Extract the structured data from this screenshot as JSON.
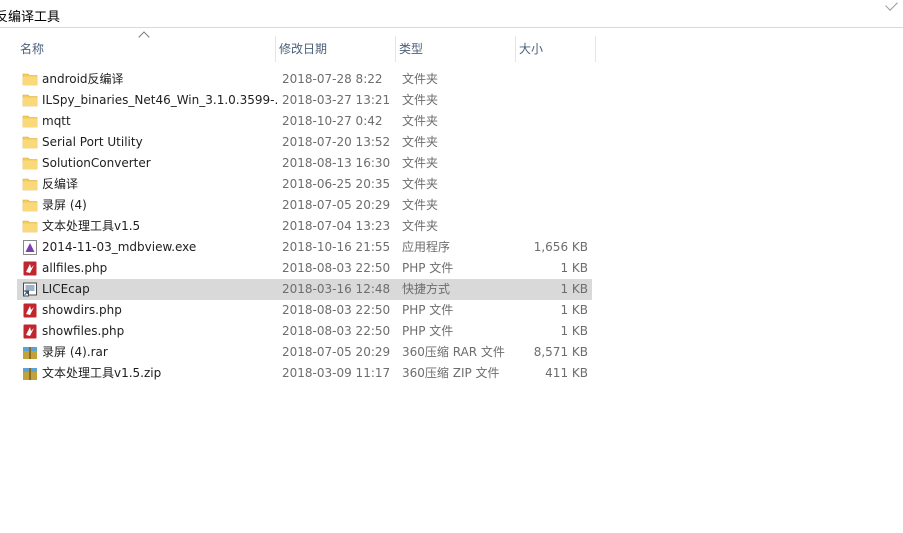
{
  "breadcrumb": {
    "current": "反编译工具"
  },
  "columns": {
    "name": "名称",
    "date": "修改日期",
    "type": "类型",
    "size": "大小"
  },
  "colors": {
    "folder": "#f6cc58",
    "php": "#c0262d",
    "exe": "#7b3fb2",
    "shortcut": "#4a4a4a",
    "archive": "#c2a23a",
    "selected_row": "#d9d9d9"
  },
  "files": [
    {
      "name": "android反编译",
      "date": "2018-07-28 8:22",
      "type": "文件夹",
      "size": "",
      "icon": "folder-icon"
    },
    {
      "name": "ILSpy_binaries_Net46_Win_3.1.0.3599-...",
      "date": "2018-03-27 13:21",
      "type": "文件夹",
      "size": "",
      "icon": "folder-icon"
    },
    {
      "name": "mqtt",
      "date": "2018-10-27 0:42",
      "type": "文件夹",
      "size": "",
      "icon": "folder-icon"
    },
    {
      "name": "Serial Port Utility",
      "date": "2018-07-20 13:52",
      "type": "文件夹",
      "size": "",
      "icon": "folder-icon"
    },
    {
      "name": "SolutionConverter",
      "date": "2018-08-13 16:30",
      "type": "文件夹",
      "size": "",
      "icon": "folder-icon"
    },
    {
      "name": "反编译",
      "date": "2018-06-25 20:35",
      "type": "文件夹",
      "size": "",
      "icon": "folder-icon"
    },
    {
      "name": "录屏 (4)",
      "date": "2018-07-05 20:29",
      "type": "文件夹",
      "size": "",
      "icon": "folder-icon"
    },
    {
      "name": "文本处理工具v1.5",
      "date": "2018-07-04 13:23",
      "type": "文件夹",
      "size": "",
      "icon": "folder-icon"
    },
    {
      "name": "2014-11-03_mdbview.exe",
      "date": "2018-10-16 21:55",
      "type": "应用程序",
      "size": "1,656 KB",
      "icon": "exe-icon"
    },
    {
      "name": "allfiles.php",
      "date": "2018-08-03 22:50",
      "type": "PHP 文件",
      "size": "1 KB",
      "icon": "php-file-icon"
    },
    {
      "name": "LICEcap",
      "date": "2018-03-16 12:48",
      "type": "快捷方式",
      "size": "1 KB",
      "icon": "shortcut-icon",
      "selected": true
    },
    {
      "name": "showdirs.php",
      "date": "2018-08-03 22:50",
      "type": "PHP 文件",
      "size": "1 KB",
      "icon": "php-file-icon"
    },
    {
      "name": "showfiles.php",
      "date": "2018-08-03 22:50",
      "type": "PHP 文件",
      "size": "1 KB",
      "icon": "php-file-icon"
    },
    {
      "name": "录屏 (4).rar",
      "date": "2018-07-05 20:29",
      "type": "360压缩 RAR 文件",
      "size": "8,571 KB",
      "icon": "rar-archive-icon"
    },
    {
      "name": "文本处理工具v1.5.zip",
      "date": "2018-03-09 11:17",
      "type": "360压缩 ZIP 文件",
      "size": "411 KB",
      "icon": "zip-archive-icon"
    }
  ]
}
